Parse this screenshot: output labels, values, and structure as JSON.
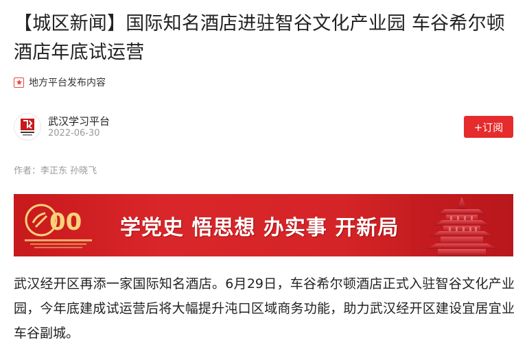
{
  "article": {
    "title": "【城区新闻】国际知名酒店进驻智谷文化产业园 车谷希尔顿酒店年底试运营",
    "source_tag": "地方平台发布内容",
    "authors": "作者：李正东 孙晓飞",
    "body": "武汉经开区再添一家国际知名酒店。6月29日，车谷希尔顿酒店正式入驻智谷文化产业园，今年底建成试运营后将大幅提升沌口区域商务功能，助力武汉经开区建设宜居宜业车谷副城。"
  },
  "publisher": {
    "name": "武汉学习平台",
    "date": "2022-06-30",
    "subscribe_label": "+订阅"
  },
  "banner": {
    "slogan": "学党史 悟思想 办实事 开新局",
    "anniversary_number": "100"
  },
  "colors": {
    "accent_red": "#e52b2b",
    "banner_red": "#d52427",
    "text_gray": "#999999"
  }
}
